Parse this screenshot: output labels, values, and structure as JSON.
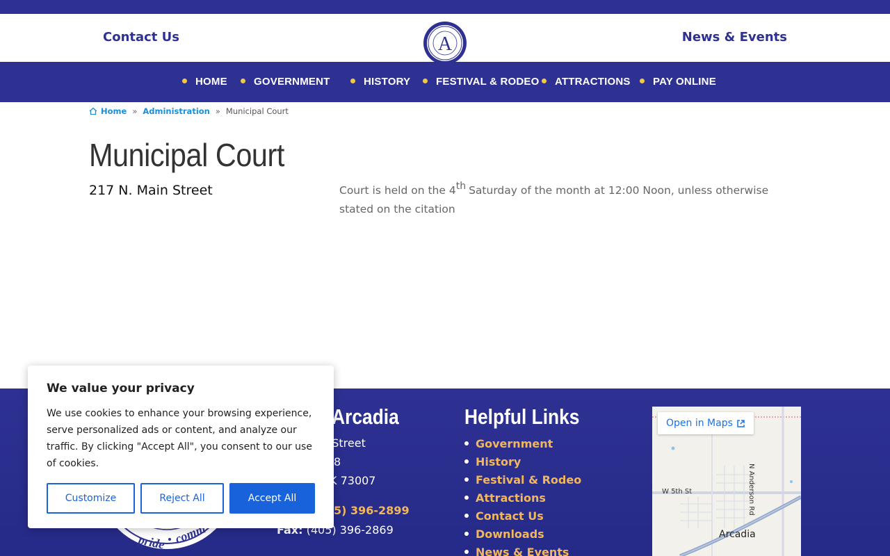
{
  "header": {
    "left_link": "Contact Us",
    "right_link": "News & Events",
    "logo_letter": "A"
  },
  "nav": {
    "items": [
      "HOME",
      "GOVERNMENT",
      "HISTORY",
      "FESTIVAL & RODEO",
      "ATTRACTIONS",
      "PAY ONLINE"
    ]
  },
  "breadcrumb": {
    "home": "Home",
    "sep": "»",
    "parent": "Administration",
    "current": "Municipal Court"
  },
  "main": {
    "title": "Municipal Court",
    "address": "217 N. Main Street",
    "court_text_before": "Court is held on the 4",
    "court_text_sup": "th",
    "court_text_after": "Saturday of the month at 12:00 Noon, unless otherwise stated on the citation"
  },
  "footer": {
    "city_title": "f Arcadia",
    "address_line1": "n Street",
    "address_line2": "8",
    "address_line3": "K 73007",
    "phone_partial": "5) 396-2899",
    "fax_label": "Fax:",
    "fax_value": "(405) 396-2869",
    "seal_text_left": "pride",
    "seal_text_right": "comm",
    "links_title": "Helpful Links",
    "links": [
      "Government",
      "History",
      "Festival & Rodeo",
      "Attractions",
      "Contact Us",
      "Downloads",
      "News & Events"
    ]
  },
  "map": {
    "open_label": "Open in Maps",
    "street_w5": "W 5th St",
    "street_anderson": "N Anderson Rd",
    "city": "Arcadia"
  },
  "cookie": {
    "title": "We value your privacy",
    "text": "We use cookies to enhance your browsing experience, serve personalized ads or content, and analyze our traffic. By clicking \"Accept All\", you consent to our use of cookies.",
    "customize": "Customize",
    "reject": "Reject All",
    "accept": "Accept All"
  },
  "colors": {
    "brand": "#2e3192",
    "accent": "#f2b75a",
    "link": "#1a8fd6",
    "cookie_button": "#1863dc"
  }
}
